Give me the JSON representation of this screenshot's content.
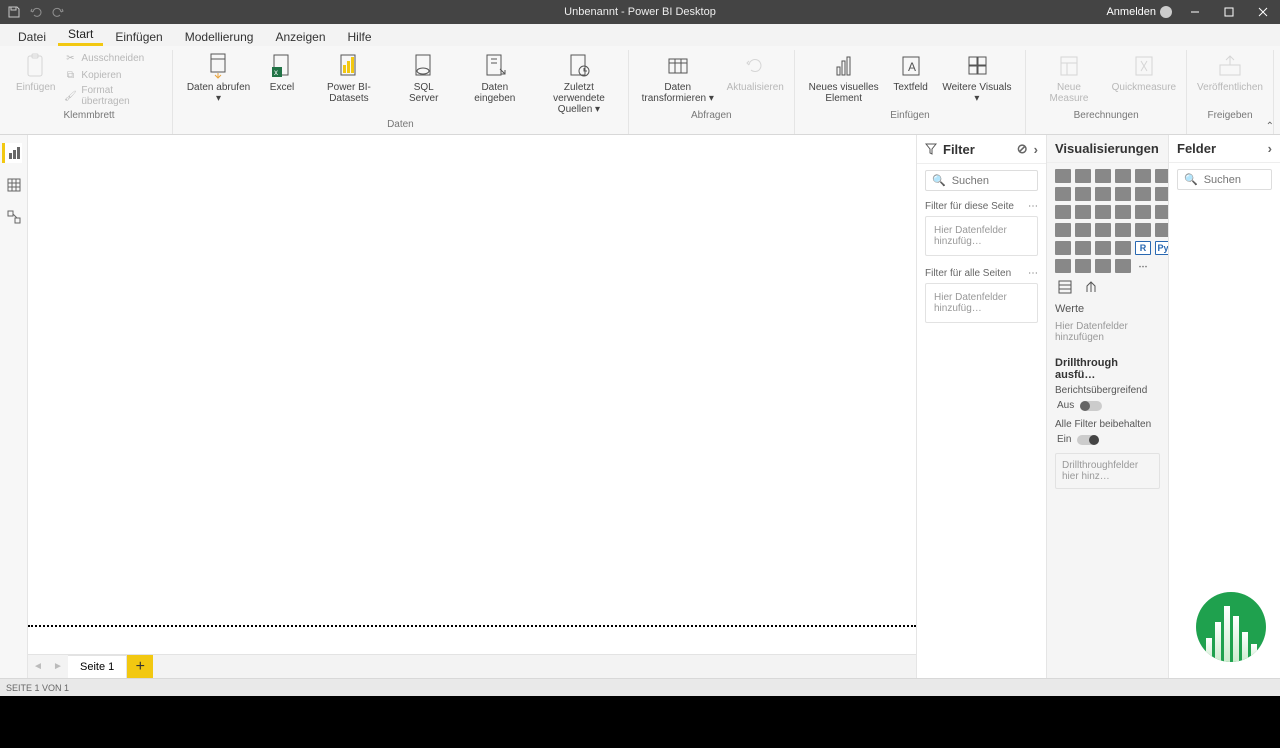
{
  "titlebar": {
    "title": "Unbenannt - Power BI Desktop",
    "signin": "Anmelden"
  },
  "tabs": {
    "file": "Datei",
    "start": "Start",
    "insert": "Einfügen",
    "modeling": "Modellierung",
    "view": "Anzeigen",
    "help": "Hilfe"
  },
  "ribbon": {
    "clipboard": {
      "group": "Klemmbrett",
      "paste": "Einfügen",
      "cut": "Ausschneiden",
      "copy": "Kopieren",
      "format": "Format übertragen"
    },
    "data": {
      "group": "Daten",
      "getdata": "Daten abrufen ▾",
      "excel": "Excel",
      "pbi": "Power BI-Datasets",
      "sql": "SQL Server",
      "enter": "Daten eingeben",
      "recent": "Zuletzt verwendete Quellen ▾"
    },
    "queries": {
      "group": "Abfragen",
      "transform": "Daten transformieren ▾",
      "refresh": "Aktualisieren"
    },
    "insert": {
      "group": "Einfügen",
      "visual": "Neues visuelles Element",
      "text": "Textfeld",
      "more": "Weitere Visuals ▾"
    },
    "calc": {
      "group": "Berechnungen",
      "measure": "Neue Measure",
      "quick": "Quickmeasure"
    },
    "share": {
      "group": "Freigeben",
      "publish": "Veröffentlichen"
    }
  },
  "filters": {
    "title": "Filter",
    "search": "Suchen",
    "page_label": "Filter für diese Seite",
    "all_label": "Filter für alle Seiten",
    "drop": "Hier Datenfelder hinzufüg…"
  },
  "viz": {
    "title": "Visualisierungen",
    "values": "Werte",
    "values_drop": "Hier Datenfelder hinzufügen",
    "drill_header": "Drillthrough ausfü…",
    "cross": "Berichtsübergreifend",
    "cross_state": "Aus",
    "keep": "Alle Filter beibehalten",
    "keep_state": "Ein",
    "drill_drop": "Drillthroughfelder hier hinz…"
  },
  "fields": {
    "title": "Felder",
    "search": "Suchen"
  },
  "pages": {
    "page1": "Seite 1"
  },
  "status": "SEITE 1 VON 1"
}
